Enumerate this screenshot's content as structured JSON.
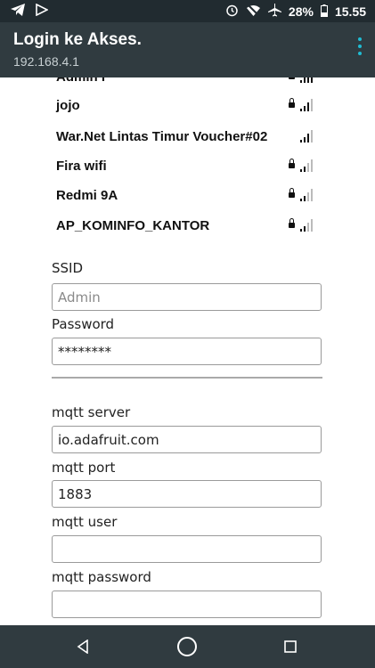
{
  "status_bar": {
    "left_icons": [
      "telegram-icon",
      "play-icon"
    ],
    "right_icons": [
      "alarm-icon",
      "wifi-off-icon",
      "airplane-icon"
    ],
    "battery": "28%",
    "time": "15.55"
  },
  "app_bar": {
    "title": "Login ke Akses.",
    "subtitle": "192.168.4.1"
  },
  "networks": [
    {
      "name": "Admin I",
      "locked": true,
      "signal": 4
    },
    {
      "name": "jojo",
      "locked": true,
      "signal": 3
    },
    {
      "name": "War.Net Lintas Timur Voucher#02",
      "locked": false,
      "signal": 3
    },
    {
      "name": "Fira wifi",
      "locked": true,
      "signal": 2
    },
    {
      "name": "Redmi 9A",
      "locked": true,
      "signal": 2
    },
    {
      "name": "AP_KOMINFO_KANTOR",
      "locked": true,
      "signal": 2
    }
  ],
  "form": {
    "ssid_label": "SSID",
    "ssid_placeholder": "Admin",
    "password_label": "Password",
    "password_value": "********",
    "mqtt_server_label": "mqtt server",
    "mqtt_server_value": "io.adafruit.com",
    "mqtt_port_label": "mqtt port",
    "mqtt_port_value": "1883",
    "mqtt_user_label": "mqtt user",
    "mqtt_user_value": "",
    "mqtt_password_label": "mqtt password",
    "mqtt_password_value": ""
  },
  "nav_bar": {
    "buttons": [
      "back-icon",
      "home-icon",
      "recents-icon"
    ]
  }
}
